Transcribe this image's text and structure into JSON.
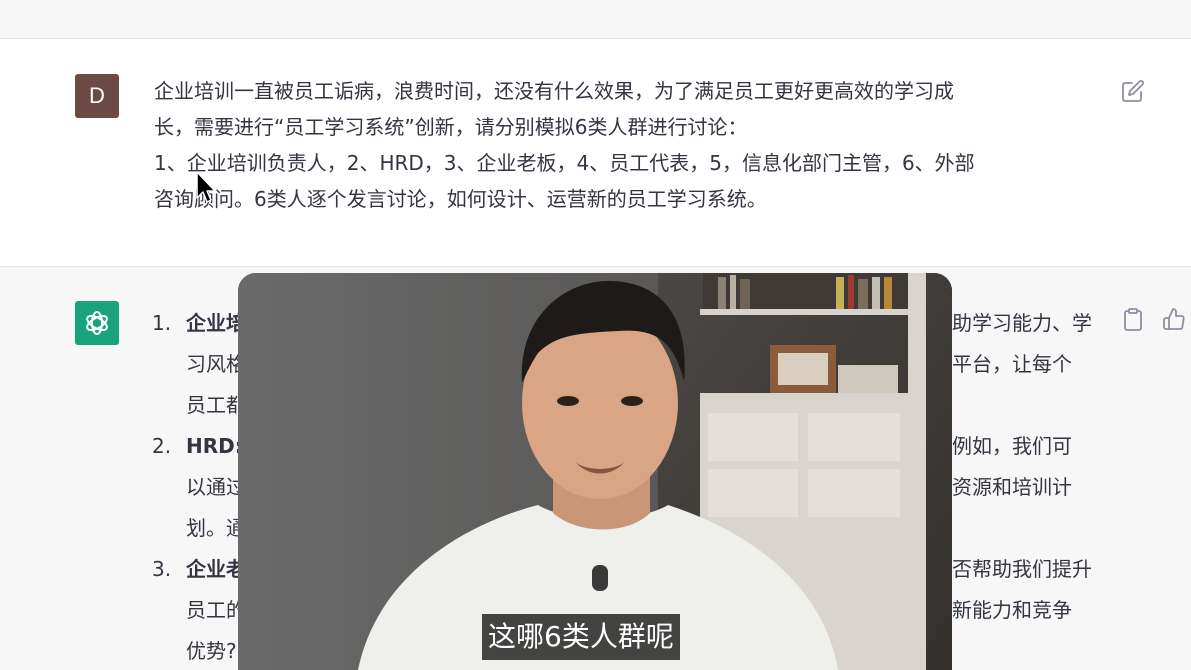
{
  "user_message": {
    "avatar_letter": "D",
    "lines": [
      "企业培训一直被员工诟病，浪费时间，还没有什么效果，为了满足员工更好更高效的学习成",
      "长，需要进行“员工学习系统”创新，请分别模拟6类人群进行讨论：",
      "1、企业培训负责人，2、HRD，3、企业老板，4、员工代表，5，信息化部门主管，6、外部",
      "咨询顾问。6类人逐个发言讨论，如何设计、运营新的员工学习系统。"
    ]
  },
  "assistant_message": {
    "items": [
      {
        "num": "1.",
        "title": "企业培",
        "right_line1": "助学习能力、学",
        "left_line2": "习风格",
        "right_line2": "平台，让每个",
        "left_line3": "员工都"
      },
      {
        "num": "2.",
        "title": "HRD:",
        "right_line1": "例如，我们可",
        "left_line2": "以通过",
        "right_line2": "资源和培训计",
        "left_line3": "划。通"
      },
      {
        "num": "3.",
        "title": "企业老",
        "right_line1": "否帮助我们提升",
        "left_line2": "员工的",
        "right_line2": "新能力和竞争",
        "left_line3": "优势?"
      }
    ]
  },
  "video": {
    "subtitle": "这哪6类人群呢"
  },
  "colors": {
    "user_avatar": "#6b4a43",
    "assistant_avatar": "#19a37c",
    "assistant_bg": "#f7f7f8"
  },
  "icons": {
    "edit": "edit-icon",
    "copy": "clipboard-icon",
    "like": "thumbs-up-icon",
    "assistant_logo": "openai-logo-icon"
  }
}
